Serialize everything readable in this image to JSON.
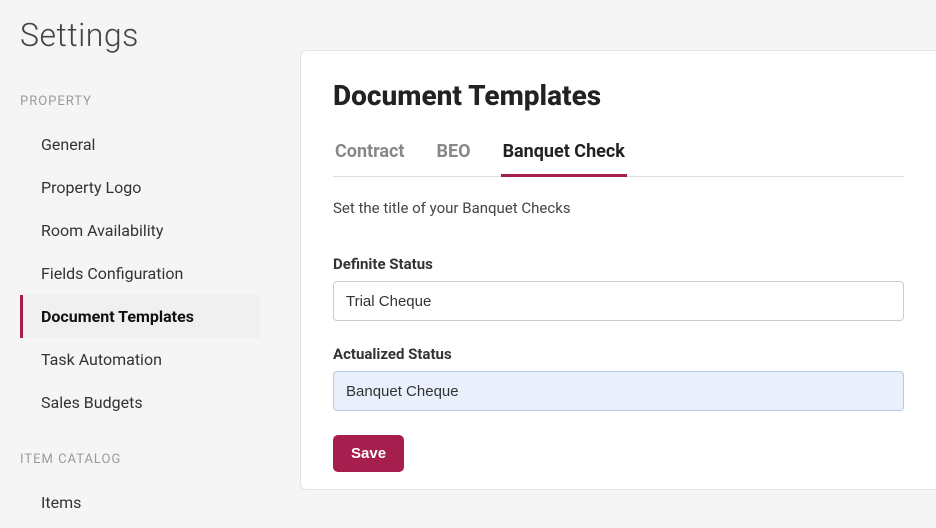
{
  "pageTitle": "Settings",
  "sidebar": {
    "sections": [
      {
        "label": "PROPERTY",
        "items": [
          {
            "label": "General",
            "active": false
          },
          {
            "label": "Property Logo",
            "active": false
          },
          {
            "label": "Room Availability",
            "active": false
          },
          {
            "label": "Fields Configuration",
            "active": false
          },
          {
            "label": "Document Templates",
            "active": true
          },
          {
            "label": "Task Automation",
            "active": false
          },
          {
            "label": "Sales Budgets",
            "active": false
          }
        ]
      },
      {
        "label": "ITEM CATALOG",
        "items": [
          {
            "label": "Items",
            "active": false
          }
        ]
      }
    ]
  },
  "panel": {
    "title": "Document Templates",
    "tabs": [
      {
        "label": "Contract",
        "active": false
      },
      {
        "label": "BEO",
        "active": false
      },
      {
        "label": "Banquet Check",
        "active": true
      }
    ],
    "helper": "Set the title of your Banquet Checks",
    "fields": {
      "definite": {
        "label": "Definite Status",
        "value": "Trial Cheque"
      },
      "actualized": {
        "label": "Actualized Status",
        "value": "Banquet Cheque"
      }
    },
    "saveLabel": "Save"
  },
  "colors": {
    "accent": "#a61e4d"
  }
}
